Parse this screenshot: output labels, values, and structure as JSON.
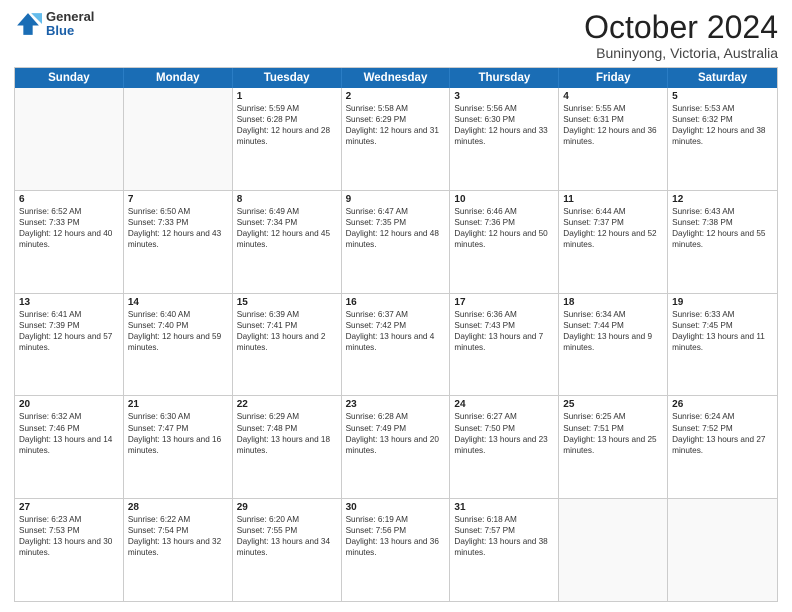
{
  "logo": {
    "general": "General",
    "blue": "Blue"
  },
  "title": "October 2024",
  "subtitle": "Buninyong, Victoria, Australia",
  "days": [
    "Sunday",
    "Monday",
    "Tuesday",
    "Wednesday",
    "Thursday",
    "Friday",
    "Saturday"
  ],
  "weeks": [
    [
      {
        "day": "",
        "sunrise": "",
        "sunset": "",
        "daylight": "",
        "empty": true
      },
      {
        "day": "",
        "sunrise": "",
        "sunset": "",
        "daylight": "",
        "empty": true
      },
      {
        "day": "1",
        "sunrise": "Sunrise: 5:59 AM",
        "sunset": "Sunset: 6:28 PM",
        "daylight": "Daylight: 12 hours and 28 minutes.",
        "empty": false
      },
      {
        "day": "2",
        "sunrise": "Sunrise: 5:58 AM",
        "sunset": "Sunset: 6:29 PM",
        "daylight": "Daylight: 12 hours and 31 minutes.",
        "empty": false
      },
      {
        "day": "3",
        "sunrise": "Sunrise: 5:56 AM",
        "sunset": "Sunset: 6:30 PM",
        "daylight": "Daylight: 12 hours and 33 minutes.",
        "empty": false
      },
      {
        "day": "4",
        "sunrise": "Sunrise: 5:55 AM",
        "sunset": "Sunset: 6:31 PM",
        "daylight": "Daylight: 12 hours and 36 minutes.",
        "empty": false
      },
      {
        "day": "5",
        "sunrise": "Sunrise: 5:53 AM",
        "sunset": "Sunset: 6:32 PM",
        "daylight": "Daylight: 12 hours and 38 minutes.",
        "empty": false
      }
    ],
    [
      {
        "day": "6",
        "sunrise": "Sunrise: 6:52 AM",
        "sunset": "Sunset: 7:33 PM",
        "daylight": "Daylight: 12 hours and 40 minutes.",
        "empty": false
      },
      {
        "day": "7",
        "sunrise": "Sunrise: 6:50 AM",
        "sunset": "Sunset: 7:33 PM",
        "daylight": "Daylight: 12 hours and 43 minutes.",
        "empty": false
      },
      {
        "day": "8",
        "sunrise": "Sunrise: 6:49 AM",
        "sunset": "Sunset: 7:34 PM",
        "daylight": "Daylight: 12 hours and 45 minutes.",
        "empty": false
      },
      {
        "day": "9",
        "sunrise": "Sunrise: 6:47 AM",
        "sunset": "Sunset: 7:35 PM",
        "daylight": "Daylight: 12 hours and 48 minutes.",
        "empty": false
      },
      {
        "day": "10",
        "sunrise": "Sunrise: 6:46 AM",
        "sunset": "Sunset: 7:36 PM",
        "daylight": "Daylight: 12 hours and 50 minutes.",
        "empty": false
      },
      {
        "day": "11",
        "sunrise": "Sunrise: 6:44 AM",
        "sunset": "Sunset: 7:37 PM",
        "daylight": "Daylight: 12 hours and 52 minutes.",
        "empty": false
      },
      {
        "day": "12",
        "sunrise": "Sunrise: 6:43 AM",
        "sunset": "Sunset: 7:38 PM",
        "daylight": "Daylight: 12 hours and 55 minutes.",
        "empty": false
      }
    ],
    [
      {
        "day": "13",
        "sunrise": "Sunrise: 6:41 AM",
        "sunset": "Sunset: 7:39 PM",
        "daylight": "Daylight: 12 hours and 57 minutes.",
        "empty": false
      },
      {
        "day": "14",
        "sunrise": "Sunrise: 6:40 AM",
        "sunset": "Sunset: 7:40 PM",
        "daylight": "Daylight: 12 hours and 59 minutes.",
        "empty": false
      },
      {
        "day": "15",
        "sunrise": "Sunrise: 6:39 AM",
        "sunset": "Sunset: 7:41 PM",
        "daylight": "Daylight: 13 hours and 2 minutes.",
        "empty": false
      },
      {
        "day": "16",
        "sunrise": "Sunrise: 6:37 AM",
        "sunset": "Sunset: 7:42 PM",
        "daylight": "Daylight: 13 hours and 4 minutes.",
        "empty": false
      },
      {
        "day": "17",
        "sunrise": "Sunrise: 6:36 AM",
        "sunset": "Sunset: 7:43 PM",
        "daylight": "Daylight: 13 hours and 7 minutes.",
        "empty": false
      },
      {
        "day": "18",
        "sunrise": "Sunrise: 6:34 AM",
        "sunset": "Sunset: 7:44 PM",
        "daylight": "Daylight: 13 hours and 9 minutes.",
        "empty": false
      },
      {
        "day": "19",
        "sunrise": "Sunrise: 6:33 AM",
        "sunset": "Sunset: 7:45 PM",
        "daylight": "Daylight: 13 hours and 11 minutes.",
        "empty": false
      }
    ],
    [
      {
        "day": "20",
        "sunrise": "Sunrise: 6:32 AM",
        "sunset": "Sunset: 7:46 PM",
        "daylight": "Daylight: 13 hours and 14 minutes.",
        "empty": false
      },
      {
        "day": "21",
        "sunrise": "Sunrise: 6:30 AM",
        "sunset": "Sunset: 7:47 PM",
        "daylight": "Daylight: 13 hours and 16 minutes.",
        "empty": false
      },
      {
        "day": "22",
        "sunrise": "Sunrise: 6:29 AM",
        "sunset": "Sunset: 7:48 PM",
        "daylight": "Daylight: 13 hours and 18 minutes.",
        "empty": false
      },
      {
        "day": "23",
        "sunrise": "Sunrise: 6:28 AM",
        "sunset": "Sunset: 7:49 PM",
        "daylight": "Daylight: 13 hours and 20 minutes.",
        "empty": false
      },
      {
        "day": "24",
        "sunrise": "Sunrise: 6:27 AM",
        "sunset": "Sunset: 7:50 PM",
        "daylight": "Daylight: 13 hours and 23 minutes.",
        "empty": false
      },
      {
        "day": "25",
        "sunrise": "Sunrise: 6:25 AM",
        "sunset": "Sunset: 7:51 PM",
        "daylight": "Daylight: 13 hours and 25 minutes.",
        "empty": false
      },
      {
        "day": "26",
        "sunrise": "Sunrise: 6:24 AM",
        "sunset": "Sunset: 7:52 PM",
        "daylight": "Daylight: 13 hours and 27 minutes.",
        "empty": false
      }
    ],
    [
      {
        "day": "27",
        "sunrise": "Sunrise: 6:23 AM",
        "sunset": "Sunset: 7:53 PM",
        "daylight": "Daylight: 13 hours and 30 minutes.",
        "empty": false
      },
      {
        "day": "28",
        "sunrise": "Sunrise: 6:22 AM",
        "sunset": "Sunset: 7:54 PM",
        "daylight": "Daylight: 13 hours and 32 minutes.",
        "empty": false
      },
      {
        "day": "29",
        "sunrise": "Sunrise: 6:20 AM",
        "sunset": "Sunset: 7:55 PM",
        "daylight": "Daylight: 13 hours and 34 minutes.",
        "empty": false
      },
      {
        "day": "30",
        "sunrise": "Sunrise: 6:19 AM",
        "sunset": "Sunset: 7:56 PM",
        "daylight": "Daylight: 13 hours and 36 minutes.",
        "empty": false
      },
      {
        "day": "31",
        "sunrise": "Sunrise: 6:18 AM",
        "sunset": "Sunset: 7:57 PM",
        "daylight": "Daylight: 13 hours and 38 minutes.",
        "empty": false
      },
      {
        "day": "",
        "sunrise": "",
        "sunset": "",
        "daylight": "",
        "empty": true
      },
      {
        "day": "",
        "sunrise": "",
        "sunset": "",
        "daylight": "",
        "empty": true
      }
    ]
  ]
}
